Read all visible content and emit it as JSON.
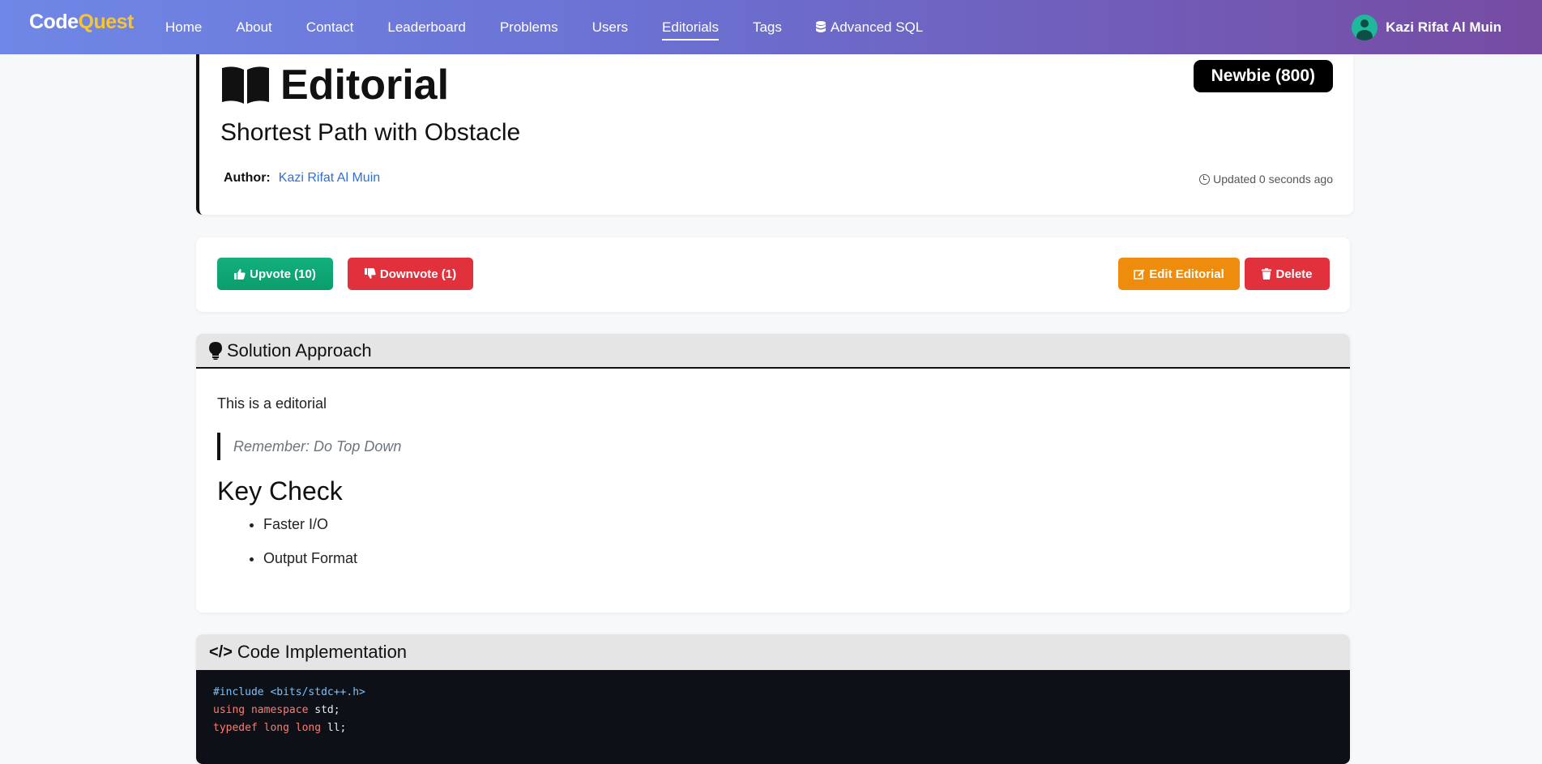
{
  "navbar": {
    "brand_part1": "Code",
    "brand_part2": "Quest",
    "links": [
      "Home",
      "About",
      "Contact",
      "Leaderboard",
      "Problems",
      "Users",
      "Editorials",
      "Tags"
    ],
    "active": "Editorials",
    "advanced_sql": "Advanced SQL",
    "user_name": "Kazi Rifat Al Muin",
    "gradient_start": "#6f87e6",
    "gradient_end": "#764ba2",
    "brand_accent": "#f7c531"
  },
  "header": {
    "title": "Editorial",
    "problem_title": "Shortest Path with Obstacle",
    "badge": "Newbie (800)",
    "author_label": "Author:",
    "author_name": "Kazi Rifat Al Muin",
    "updated": "Updated 0 seconds ago"
  },
  "actions": {
    "upvote": "Upvote (10)",
    "downvote": "Downvote (1)",
    "edit": "Edit Editorial",
    "delete": "Delete"
  },
  "solution": {
    "heading": "Solution Approach",
    "text": "This is a editorial",
    "quote": "Remember: Do Top Down",
    "subheading": "Key Check",
    "items": [
      "Faster I/O",
      "Output Format"
    ]
  },
  "code": {
    "heading": "Code Implementation",
    "line1_directive": "#include",
    "line1_header": "<bits/stdc++.h>",
    "line2_kw1": "using",
    "line2_kw2": "namespace",
    "line2_rest": "std;",
    "line3_kw": "typedef",
    "line3_type": "long long",
    "line3_rest": "ll;"
  }
}
